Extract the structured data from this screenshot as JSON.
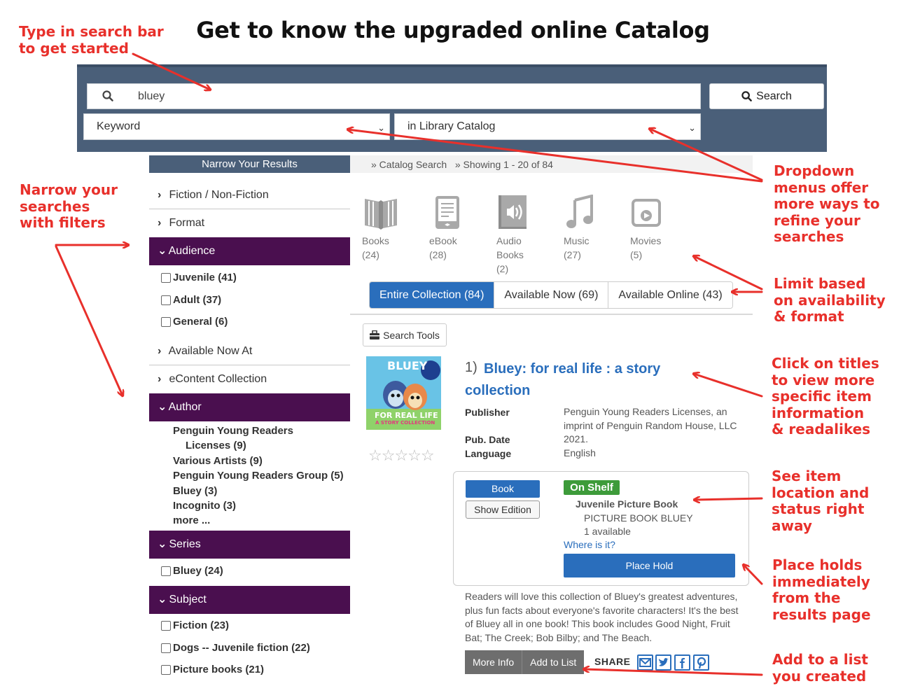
{
  "title": "Get to know the upgraded online Catalog",
  "annotations": {
    "search_bar": "Type in search bar\nto get started",
    "filters": "Narrow your\nsearches\nwith filters",
    "dropdowns": "Dropdown\nmenus offer\nmore ways to\nrefine your\nsearches",
    "limit": "Limit based\non availability\n& format",
    "titles": "Click on titles\nto view more\nspecific item\ninformation\n& readalikes",
    "status": "See item\nlocation and\nstatus right\naway",
    "holds": "Place holds\nimmediately\nfrom the\nresults page",
    "list": "Add to a list\nyou created"
  },
  "search": {
    "value": "bluey",
    "button_label": "Search",
    "search_type": "Keyword",
    "search_scope": "in Library Catalog"
  },
  "sidebar": {
    "header": "Narrow Your Results",
    "fiction": "Fiction / Non-Fiction",
    "format": "Format",
    "audience": {
      "label": "Audience",
      "options": [
        "Juvenile (41)",
        "Adult (37)",
        "General (6)"
      ]
    },
    "available_now_at": "Available Now At",
    "econtent": "eContent Collection",
    "author": {
      "label": "Author",
      "options": [
        "Penguin Young Readers",
        "Licenses (9)",
        "Various Artists (9)",
        "Penguin Young Readers Group (5)",
        "Bluey (3)",
        "Incognito (3)",
        "more ..."
      ]
    },
    "series": {
      "label": "Series",
      "options": [
        "Bluey (24)"
      ]
    },
    "subject": {
      "label": "Subject",
      "options": [
        "Fiction (23)",
        "Dogs -- Juvenile fiction (22)",
        "Picture books (21)"
      ]
    }
  },
  "breadcrumb": {
    "catalog_search": "» Catalog Search",
    "showing": "» Showing 1 - 20 of 84"
  },
  "formats": [
    {
      "label": "Books",
      "count": "(24)",
      "icon": "book-icon"
    },
    {
      "label": "eBook",
      "count": "(28)",
      "icon": "ebook-icon"
    },
    {
      "label": "Audio",
      "label2": "Books",
      "count": "(2)",
      "icon": "audiobook-icon"
    },
    {
      "label": "Music",
      "count": "(27)",
      "icon": "music-note-icon"
    },
    {
      "label": "Movies",
      "count": "(5)",
      "icon": "movie-icon"
    }
  ],
  "tabs": [
    "Entire Collection (84)",
    "Available Now (69)",
    "Available Online (43)"
  ],
  "search_tools": "Search Tools",
  "result": {
    "number": "1)",
    "title": "Bluey: for real life : a story collection",
    "cover_text": [
      "BLUEY",
      "FOR REAL LIFE",
      "A STORY COLLECTION"
    ],
    "rating": 0,
    "stars": "☆☆☆☆☆",
    "publisher_label": "Publisher",
    "publisher": "Penguin Young Readers Licenses, an imprint of Penguin Random House, LLC",
    "pub_date_label": "Pub. Date",
    "pub_date": "2021.",
    "language_label": "Language",
    "language": "English",
    "format_button": "Book",
    "show_edition": "Show Edition",
    "status": "On Shelf",
    "collection": "Juvenile Picture Book",
    "call_number": "PICTURE BOOK BLUEY",
    "availability": "1 available",
    "where_is_it": "Where is it?",
    "place_hold": "Place Hold",
    "description": "Readers will love this collection of Bluey's greatest adventures, plus fun facts about everyone's favorite characters! It's the best of Bluey all in one book! This book includes Good Night, Fruit Bat; The Creek; Bob Bilby; and The Beach.",
    "more_info": "More Info",
    "add_to_list": "Add to List",
    "share": "SHARE"
  },
  "colors": {
    "header_band": "#4a5f79",
    "facet_open": "#4a0f4f",
    "link_blue": "#2a6ebc",
    "annotation_red": "#e8302b",
    "status_green": "#3d9b3a"
  }
}
